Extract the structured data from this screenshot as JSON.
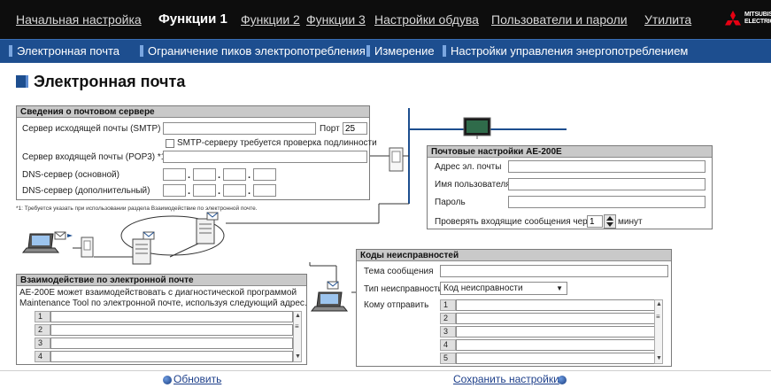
{
  "nav": {
    "items": [
      "Начальная настройка",
      "Функции 1",
      "Функции 2",
      "Функции 3",
      "Настройки обдува",
      "Пользователи и пароли",
      "Утилита"
    ],
    "active_index": 1,
    "brand_line1": "MITSUBISHI",
    "brand_line2": "ELECTRIC"
  },
  "subnav": {
    "items": [
      "Электронная почта",
      "Ограничение пиков электропотребления",
      "Измерение",
      "Настройки управления энергопотреблением"
    ]
  },
  "page": {
    "title": "Электронная почта"
  },
  "mail_server": {
    "header": "Сведения о почтовом сервере",
    "smtp_label": "Сервер исходящей почты (SMTP)",
    "smtp_value": "",
    "port_label": "Порт",
    "port_value": "25",
    "auth_label": "SMTP-серверу требуется проверка подлинности",
    "auth_checked": false,
    "pop3_label": "Сервер входящей почты (POP3) *1",
    "pop3_value": "",
    "dns1_label": "DNS-сервер (основной)",
    "dns2_label": "DNS-сервер (дополнительный)",
    "footnote": "*1: Требуется указать при использовании раздела Взаимодействие по электронной почте."
  },
  "mail_settings": {
    "header": "Почтовые настройки AE-200E",
    "email_label": "Адрес эл. почты",
    "email_value": "",
    "user_label": "Имя пользователя",
    "user_value": "",
    "password_label": "Пароль",
    "password_value": "",
    "check_label": "Проверять входящие сообщения через",
    "check_value": "1",
    "minutes_label": "минут"
  },
  "interaction": {
    "header": "Взаимодействие по электронной почте",
    "description_line1": "AE-200E может взаимодействовать с диагностической программой",
    "description_line2": "Maintenance Tool по электронной почте, используя следующий адрес.",
    "rows": [
      "1",
      "2",
      "3",
      "4"
    ]
  },
  "fault_codes": {
    "header": "Коды неисправностей",
    "subject_label": "Тема сообщения",
    "subject_value": "",
    "type_label": "Тип неисправности",
    "type_value": "Код неисправности",
    "send_to_label": "Кому отправить",
    "rows": [
      "1",
      "2",
      "3",
      "4",
      "5"
    ]
  },
  "footer": {
    "refresh_label": "Обновить",
    "save_label": "Сохранить настройки"
  }
}
